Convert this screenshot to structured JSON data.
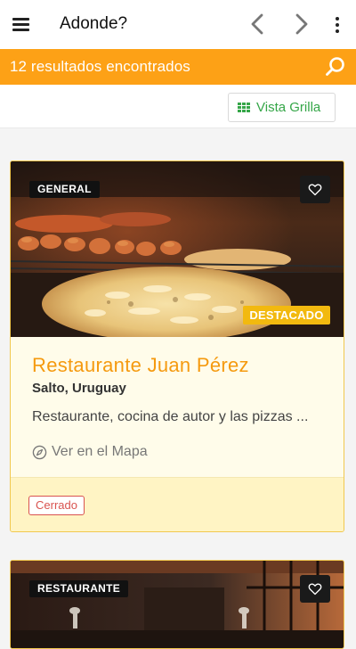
{
  "app_bar": {
    "title": "Adonde?",
    "icons": [
      "menu-icon",
      "chevron-left-icon",
      "chevron-right-icon",
      "more-vert-icon"
    ]
  },
  "results": {
    "text": "12 resultados encontrados",
    "icon": "search-icon"
  },
  "toolbar": {
    "grid_label": "Vista Grilla",
    "grid_icon": "grid-icon"
  },
  "colors": {
    "accent": "#fda116",
    "title_orange": "#f59a0f",
    "grid_green": "#35a648",
    "featured_yellow": "#f2b90f",
    "closed_red": "#d9534f",
    "card_bg": "#fffcea"
  },
  "cards": [
    {
      "category": "GENERAL",
      "featured": "DESTACADO",
      "name": "Restaurante Juan Pérez",
      "location": "Salto, Uruguay",
      "description": "Restaurante, cocina de autor y las pizzas ...",
      "map_label": "Ver en el Mapa",
      "status": "Cerrado"
    },
    {
      "category": "RESTAURANTE"
    }
  ]
}
